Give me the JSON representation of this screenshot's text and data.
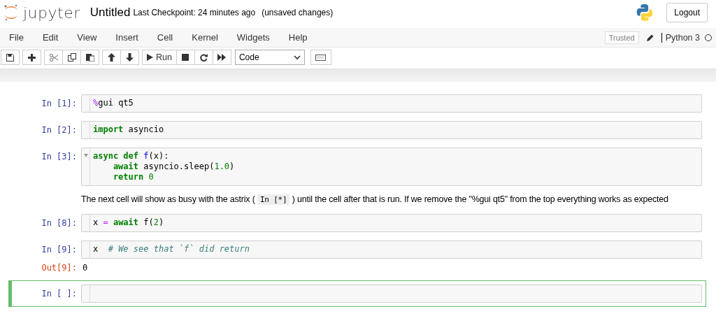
{
  "header": {
    "logo_text": "jupyter",
    "notebook_name": "Untitled",
    "checkpoint": "Last Checkpoint: 24 minutes ago",
    "autosave": "(unsaved changes)",
    "logout": "Logout"
  },
  "menu": [
    "File",
    "Edit",
    "View",
    "Insert",
    "Cell",
    "Kernel",
    "Widgets",
    "Help"
  ],
  "trusted": "Trusted",
  "kernel": {
    "name": "Python 3",
    "busy": false
  },
  "toolbar": {
    "run_label": "Run",
    "cell_type": "Code"
  },
  "cells": [
    {
      "kind": "code",
      "prompt": "In [1]:",
      "selected": false,
      "foldable": false,
      "lines": [
        [
          {
            "kind": "magic",
            "text": "%"
          },
          {
            "kind": "plain",
            "text": "gui qt5"
          }
        ]
      ]
    },
    {
      "kind": "code",
      "prompt": "In [2]:",
      "selected": false,
      "foldable": false,
      "lines": [
        [
          {
            "kind": "keyword",
            "text": "import"
          },
          {
            "kind": "plain",
            "text": " asyncio"
          }
        ]
      ]
    },
    {
      "kind": "code",
      "prompt": "In [3]:",
      "selected": false,
      "foldable": true,
      "lines": [
        [
          {
            "kind": "keyword",
            "text": "async "
          },
          {
            "kind": "keyword",
            "text": "def "
          },
          {
            "kind": "def",
            "text": "f"
          },
          {
            "kind": "plain",
            "text": "(x):"
          }
        ],
        [
          {
            "kind": "keyword",
            "text": "    await"
          },
          {
            "kind": "plain",
            "text": " asyncio.sleep("
          },
          {
            "kind": "number",
            "text": "1.0"
          },
          {
            "kind": "plain",
            "text": ")"
          }
        ],
        [
          {
            "kind": "keyword",
            "text": "    return "
          },
          {
            "kind": "number",
            "text": "0"
          }
        ]
      ]
    },
    {
      "kind": "markdown",
      "segments": [
        {
          "kind": "plain",
          "text": "The next cell will show as busy with the astrix ( "
        },
        {
          "kind": "code",
          "text": "In [*]"
        },
        {
          "kind": "plain",
          "text": " ) until the cell after that is run. If we remove the \"%gui qt5\" from the top everything works as expected"
        }
      ]
    },
    {
      "kind": "code",
      "prompt": "In [8]:",
      "selected": false,
      "foldable": false,
      "lines": [
        [
          {
            "kind": "plain",
            "text": "x "
          },
          {
            "kind": "operator",
            "text": "= "
          },
          {
            "kind": "keyword",
            "text": "await"
          },
          {
            "kind": "plain",
            "text": " f("
          },
          {
            "kind": "number",
            "text": "2"
          },
          {
            "kind": "plain",
            "text": ")"
          }
        ]
      ]
    },
    {
      "kind": "code",
      "prompt": "In [9]:",
      "selected": false,
      "foldable": false,
      "lines": [
        [
          {
            "kind": "plain",
            "text": "x  "
          },
          {
            "kind": "comment",
            "text": "# We see that `f` did return"
          }
        ]
      ],
      "output": {
        "prompt": "Out[9]:",
        "text": "0"
      }
    },
    {
      "kind": "code",
      "prompt": "In [ ]:",
      "selected": true,
      "foldable": false
    }
  ]
}
